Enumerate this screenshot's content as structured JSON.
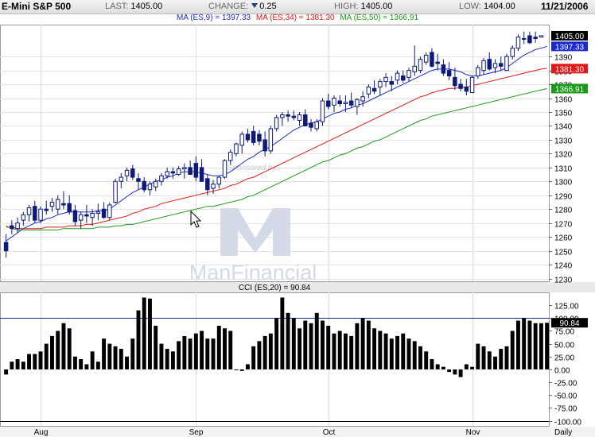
{
  "header": {
    "symbol": "E-Mini S&P 500",
    "last_label": "LAST:",
    "last": "1405.00",
    "change_label": "CHANGE:",
    "change": "0.25",
    "high_label": "HIGH:",
    "high": "1405.00",
    "low_label": "LOW:",
    "low": "1404.00",
    "date": "11/21/2006"
  },
  "ma_legend": {
    "ma9": "MA (ES,9) = 1397.33",
    "ma34": "MA (ES,34) = 1381.30",
    "ma50": "MA (ES,50) = 1366.91"
  },
  "cci_title": "CCI (ES,20) = 90.84",
  "watermark": {
    "line1": "Sponsored by:",
    "line2": "ManFinancial"
  },
  "interval_label": "Daily",
  "chart_data": [
    {
      "type": "candlestick",
      "title": "E-Mini S&P 500",
      "ylim": [
        1228,
        1413
      ],
      "y_ticks": [
        1230,
        1240,
        1250,
        1260,
        1270,
        1280,
        1290,
        1300,
        1310,
        1320,
        1330,
        1340,
        1350,
        1360,
        1370,
        1380,
        1390
      ],
      "x_labels": [
        {
          "index": 6,
          "label": "Aug"
        },
        {
          "index": 33,
          "label": "Sep"
        },
        {
          "index": 56,
          "label": "Oct"
        },
        {
          "index": 81,
          "label": "Nov"
        }
      ],
      "price_tags": [
        {
          "value": 1405.0,
          "label": "1405.00",
          "color": "#000000"
        },
        {
          "value": 1397.33,
          "label": "1397.33",
          "color": "#1a2ad0"
        },
        {
          "value": 1381.3,
          "label": "1381.30",
          "color": "#e01818"
        },
        {
          "value": 1366.91,
          "label": "1366.91",
          "color": "#1a9a1a"
        }
      ],
      "ohlc": [
        [
          1256,
          1262,
          1245,
          1250
        ],
        [
          1268,
          1272,
          1262,
          1266
        ],
        [
          1266,
          1274,
          1263,
          1270
        ],
        [
          1272,
          1278,
          1268,
          1276
        ],
        [
          1276,
          1283,
          1271,
          1281
        ],
        [
          1282,
          1286,
          1270,
          1272
        ],
        [
          1272,
          1282,
          1270,
          1280
        ],
        [
          1280,
          1286,
          1276,
          1279
        ],
        [
          1282,
          1288,
          1278,
          1285
        ],
        [
          1280,
          1290,
          1276,
          1287
        ],
        [
          1284,
          1293,
          1280,
          1283
        ],
        [
          1284,
          1290,
          1276,
          1278
        ],
        [
          1279,
          1283,
          1268,
          1271
        ],
        [
          1272,
          1278,
          1266,
          1276
        ],
        [
          1276,
          1283,
          1270,
          1275
        ],
        [
          1274,
          1280,
          1268,
          1277
        ],
        [
          1277,
          1284,
          1272,
          1278
        ],
        [
          1280,
          1285,
          1273,
          1274
        ],
        [
          1274,
          1285,
          1272,
          1283
        ],
        [
          1285,
          1302,
          1284,
          1300
        ],
        [
          1300,
          1306,
          1295,
          1303
        ],
        [
          1304,
          1310,
          1300,
          1308
        ],
        [
          1309,
          1312,
          1301,
          1303
        ],
        [
          1302,
          1306,
          1294,
          1300
        ],
        [
          1300,
          1303,
          1292,
          1294
        ],
        [
          1294,
          1300,
          1290,
          1298
        ],
        [
          1296,
          1302,
          1293,
          1300
        ],
        [
          1300,
          1306,
          1297,
          1304
        ],
        [
          1304,
          1310,
          1302,
          1307
        ],
        [
          1307,
          1310,
          1302,
          1306
        ],
        [
          1305,
          1311,
          1304,
          1309
        ],
        [
          1309,
          1313,
          1302,
          1310
        ],
        [
          1310,
          1315,
          1306,
          1305
        ],
        [
          1313,
          1318,
          1300,
          1303
        ],
        [
          1310,
          1316,
          1304,
          1300
        ],
        [
          1302,
          1305,
          1290,
          1294
        ],
        [
          1295,
          1301,
          1291,
          1298
        ],
        [
          1298,
          1304,
          1295,
          1303
        ],
        [
          1303,
          1316,
          1302,
          1315
        ],
        [
          1315,
          1323,
          1312,
          1321
        ],
        [
          1320,
          1328,
          1318,
          1327
        ],
        [
          1326,
          1336,
          1320,
          1334
        ],
        [
          1334,
          1338,
          1328,
          1330
        ],
        [
          1336,
          1340,
          1326,
          1328
        ],
        [
          1334,
          1337,
          1326,
          1329
        ],
        [
          1330,
          1336,
          1318,
          1322
        ],
        [
          1322,
          1340,
          1320,
          1338
        ],
        [
          1338,
          1348,
          1336,
          1346
        ],
        [
          1346,
          1350,
          1340,
          1348
        ],
        [
          1348,
          1351,
          1343,
          1347
        ],
        [
          1347,
          1351,
          1344,
          1346
        ],
        [
          1344,
          1350,
          1340,
          1348
        ],
        [
          1348,
          1352,
          1342,
          1340
        ],
        [
          1342,
          1345,
          1336,
          1339
        ],
        [
          1338,
          1345,
          1336,
          1343
        ],
        [
          1343,
          1360,
          1340,
          1358
        ],
        [
          1358,
          1363,
          1352,
          1354
        ],
        [
          1355,
          1362,
          1350,
          1360
        ],
        [
          1358,
          1362,
          1354,
          1356
        ],
        [
          1356,
          1362,
          1350,
          1357
        ],
        [
          1358,
          1364,
          1353,
          1355
        ],
        [
          1354,
          1360,
          1348,
          1359
        ],
        [
          1358,
          1365,
          1354,
          1361
        ],
        [
          1363,
          1370,
          1360,
          1368
        ],
        [
          1367,
          1373,
          1363,
          1365
        ],
        [
          1368,
          1374,
          1362,
          1372
        ],
        [
          1372,
          1378,
          1368,
          1375
        ],
        [
          1372,
          1376,
          1365,
          1370
        ],
        [
          1373,
          1380,
          1370,
          1378
        ],
        [
          1376,
          1380,
          1371,
          1373
        ],
        [
          1375,
          1382,
          1372,
          1380
        ],
        [
          1379,
          1398,
          1376,
          1383
        ],
        [
          1380,
          1390,
          1378,
          1388
        ],
        [
          1386,
          1393,
          1384,
          1391
        ],
        [
          1393,
          1396,
          1382,
          1383
        ],
        [
          1386,
          1392,
          1380,
          1385
        ],
        [
          1384,
          1388,
          1376,
          1378
        ],
        [
          1380,
          1386,
          1373,
          1376
        ],
        [
          1375,
          1382,
          1366,
          1369
        ],
        [
          1370,
          1374,
          1365,
          1367
        ],
        [
          1368,
          1374,
          1362,
          1365
        ],
        [
          1364,
          1376,
          1364,
          1375
        ],
        [
          1376,
          1384,
          1374,
          1382
        ],
        [
          1380,
          1389,
          1377,
          1387
        ],
        [
          1388,
          1393,
          1380,
          1381
        ],
        [
          1382,
          1388,
          1378,
          1385
        ],
        [
          1385,
          1390,
          1380,
          1383
        ],
        [
          1380,
          1392,
          1380,
          1390
        ],
        [
          1390,
          1398,
          1388,
          1396
        ],
        [
          1396,
          1406,
          1394,
          1404
        ],
        [
          1403,
          1408,
          1399,
          1403
        ],
        [
          1405,
          1408,
          1399,
          1400
        ],
        [
          1404,
          1408,
          1400,
          1403
        ],
        [
          1404,
          1405,
          1404,
          1405
        ]
      ],
      "series": [
        {
          "name": "MA (ES,9)",
          "color": "#1a2ad0",
          "values": [
            1257,
            1260,
            1263,
            1266,
            1268,
            1270,
            1271,
            1273,
            1274,
            1276,
            1277,
            1278,
            1278,
            1278,
            1278,
            1278,
            1279,
            1279,
            1280,
            1283,
            1286,
            1289,
            1292,
            1294,
            1296,
            1298,
            1300,
            1301,
            1303,
            1304,
            1306,
            1307,
            1307,
            1307,
            1306,
            1305,
            1304,
            1304,
            1305,
            1307,
            1310,
            1313,
            1316,
            1318,
            1321,
            1323,
            1325,
            1328,
            1331,
            1334,
            1337,
            1339,
            1341,
            1342,
            1343,
            1345,
            1347,
            1349,
            1350,
            1352,
            1353,
            1355,
            1356,
            1358,
            1360,
            1362,
            1364,
            1366,
            1368,
            1370,
            1372,
            1374,
            1376,
            1378,
            1380,
            1381,
            1381,
            1381,
            1380,
            1379,
            1377,
            1376,
            1376,
            1377,
            1378,
            1379,
            1380,
            1382,
            1385,
            1388,
            1391,
            1393,
            1395,
            1396,
            1397.33
          ]
        },
        {
          "name": "MA (ES,34)",
          "color": "#e01818",
          "values": [
            1267,
            1267,
            1266,
            1266,
            1266,
            1266,
            1266,
            1267,
            1267,
            1267,
            1267,
            1268,
            1268,
            1268,
            1269,
            1269,
            1270,
            1271,
            1272,
            1273,
            1274,
            1275,
            1277,
            1278,
            1280,
            1281,
            1282,
            1284,
            1285,
            1286,
            1287,
            1288,
            1289,
            1290,
            1291,
            1292,
            1293,
            1294,
            1295,
            1297,
            1298,
            1300,
            1302,
            1303,
            1305,
            1307,
            1309,
            1311,
            1313,
            1315,
            1317,
            1319,
            1321,
            1323,
            1325,
            1327,
            1329,
            1331,
            1333,
            1335,
            1337,
            1339,
            1341,
            1343,
            1345,
            1347,
            1349,
            1351,
            1353,
            1355,
            1357,
            1359,
            1361,
            1362,
            1364,
            1365,
            1366,
            1367,
            1367,
            1368,
            1368,
            1369,
            1370,
            1371,
            1372,
            1373,
            1374,
            1375,
            1376,
            1377,
            1378,
            1379,
            1380,
            1381,
            1381.3
          ]
        },
        {
          "name": "MA (ES,50)",
          "color": "#1a9a1a",
          "values": [
            1268,
            1266,
            1265,
            1265,
            1265,
            1265,
            1265,
            1265,
            1265,
            1265,
            1266,
            1266,
            1266,
            1266,
            1266,
            1266,
            1267,
            1267,
            1267,
            1268,
            1268,
            1269,
            1269,
            1270,
            1271,
            1272,
            1273,
            1274,
            1275,
            1276,
            1277,
            1278,
            1279,
            1280,
            1281,
            1282,
            1282,
            1283,
            1284,
            1285,
            1286,
            1287,
            1289,
            1290,
            1292,
            1294,
            1296,
            1298,
            1300,
            1302,
            1304,
            1306,
            1308,
            1310,
            1312,
            1314,
            1315,
            1317,
            1319,
            1320,
            1322,
            1324,
            1325,
            1327,
            1329,
            1330,
            1332,
            1334,
            1336,
            1338,
            1340,
            1342,
            1344,
            1345,
            1347,
            1348,
            1349,
            1350,
            1351,
            1352,
            1353,
            1354,
            1355,
            1356,
            1357,
            1358,
            1359,
            1360,
            1361,
            1362,
            1363,
            1364,
            1365,
            1366,
            1366.91
          ]
        }
      ]
    },
    {
      "type": "bar",
      "title": "CCI (ES,20) = 90.84",
      "ylim": [
        -110,
        150
      ],
      "y_ticks": [
        125,
        100,
        75,
        50,
        25,
        0,
        -25,
        -50,
        -75,
        -100
      ],
      "y_tick_labels": [
        "125.00",
        "100.00",
        "75.00",
        "50.00",
        "25.00",
        "0.00",
        "-25.00",
        "-50.00",
        "-75.00",
        "-100.00"
      ],
      "reference_line": 100,
      "last_value_label": "90.84",
      "values": [
        -10,
        15,
        20,
        15,
        30,
        30,
        35,
        50,
        65,
        75,
        90,
        80,
        25,
        20,
        10,
        35,
        15,
        60,
        50,
        45,
        40,
        25,
        60,
        115,
        140,
        138,
        85,
        50,
        40,
        35,
        55,
        65,
        60,
        70,
        75,
        60,
        60,
        85,
        80,
        75,
        0,
        -3,
        10,
        45,
        55,
        65,
        70,
        100,
        140,
        110,
        100,
        80,
        95,
        90,
        110,
        95,
        85,
        70,
        75,
        70,
        65,
        90,
        100,
        95,
        80,
        75,
        70,
        60,
        65,
        70,
        60,
        55,
        45,
        35,
        20,
        10,
        5,
        -5,
        -10,
        -15,
        10,
        5,
        50,
        45,
        35,
        25,
        40,
        45,
        75,
        95,
        100,
        95,
        90,
        90,
        90.84
      ]
    }
  ]
}
